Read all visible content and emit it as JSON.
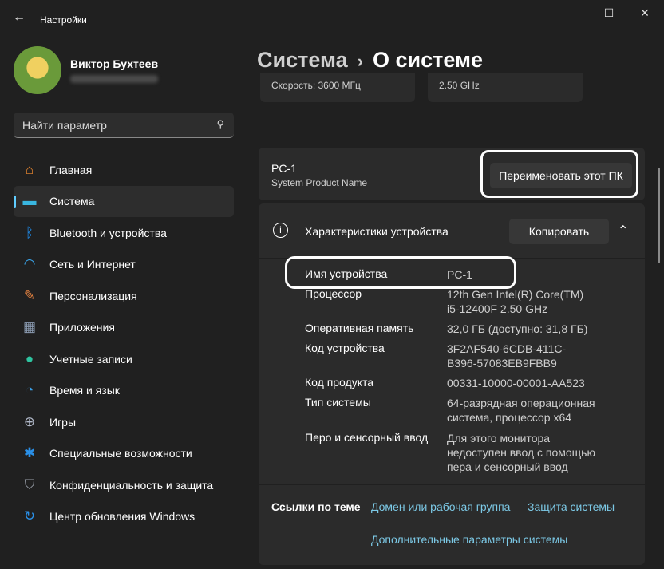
{
  "window": {
    "title": "Настройки",
    "back_icon": "arrow-left-icon",
    "minimize": "—",
    "maximize": "☐",
    "close": "✕"
  },
  "user": {
    "name": "Виктор Бухтеев"
  },
  "search": {
    "placeholder": "Найти параметр",
    "icon": "search-icon"
  },
  "nav": [
    {
      "label": "Главная",
      "icon": "home-icon",
      "color": "#f08a30"
    },
    {
      "label": "Система",
      "icon": "monitor-icon",
      "color": "#39b6e0",
      "active": true
    },
    {
      "label": "Bluetooth и устройства",
      "icon": "bluetooth-icon",
      "color": "#1f8ff0"
    },
    {
      "label": "Сеть и Интернет",
      "icon": "wifi-icon",
      "color": "#3aa8f0"
    },
    {
      "label": "Персонализация",
      "icon": "brush-icon",
      "color": "#e08040"
    },
    {
      "label": "Приложения",
      "icon": "apps-icon",
      "color": "#8a9ab0"
    },
    {
      "label": "Учетные записи",
      "icon": "account-icon",
      "color": "#2ec4a0"
    },
    {
      "label": "Время и язык",
      "icon": "globe-clock-icon",
      "color": "#3aa0e8"
    },
    {
      "label": "Игры",
      "icon": "gamepad-icon",
      "color": "#b0b8c8"
    },
    {
      "label": "Специальные возможности",
      "icon": "accessibility-icon",
      "color": "#2a90e8"
    },
    {
      "label": "Конфиденциальность и защита",
      "icon": "shield-icon",
      "color": "#9aa0aa"
    },
    {
      "label": "Центр обновления Windows",
      "icon": "update-icon",
      "color": "#2a90e8"
    }
  ],
  "breadcrumb": {
    "parent": "Система",
    "current": "О системе"
  },
  "top_cards": [
    "Скорость: 3600 МГц",
    "2.50 GHz"
  ],
  "pc": {
    "name": "PC-1",
    "model": "System Product Name",
    "rename_label": "Переименовать этот ПК"
  },
  "specs": {
    "title": "Характеристики устройства",
    "copy_label": "Копировать",
    "rows": [
      {
        "label": "Имя устройства",
        "value": "PC-1"
      },
      {
        "label": "Процессор",
        "value": "12th Gen Intel(R) Core(TM) i5-12400F   2.50 GHz"
      },
      {
        "label": "Оперативная память",
        "value": "32,0 ГБ (доступно: 31,8 ГБ)"
      },
      {
        "label": "Код устройства",
        "value": "3F2AF540-6CDB-411C-B396-57083EB9FBB9"
      },
      {
        "label": "Код продукта",
        "value": "00331-10000-00001-AA523"
      },
      {
        "label": "Тип системы",
        "value": "64-разрядная операционная система, процессор x64"
      },
      {
        "label": "Перо и сенсорный ввод",
        "value": "Для этого монитора недоступен ввод с помощью пера и сенсорный ввод"
      }
    ]
  },
  "links": {
    "title": "Ссылки по теме",
    "items": [
      "Домен или рабочая группа",
      "Защита системы",
      "Дополнительные параметры системы"
    ]
  }
}
